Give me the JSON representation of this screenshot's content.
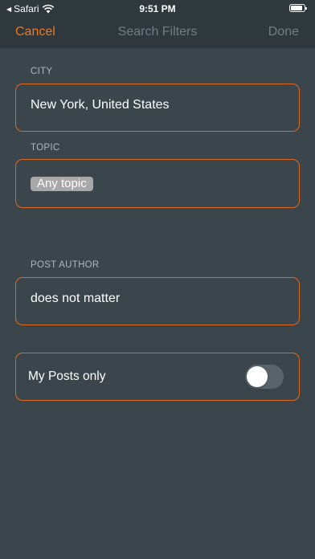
{
  "status_bar": {
    "back_app": "Safari",
    "time": "9:51 PM"
  },
  "nav": {
    "cancel_label": "Cancel",
    "title": "Search Filters",
    "done_label": "Done"
  },
  "city": {
    "label": "CITY",
    "value": "New York, United States"
  },
  "topic": {
    "label": "TOPIC",
    "chip": "Any topic"
  },
  "post_author": {
    "label": "POST AUTHOR",
    "value": "does not matter"
  },
  "my_posts": {
    "label": "My Posts only",
    "enabled": false
  },
  "colors": {
    "accent": "#f0781e",
    "background": "#3b464c",
    "bar": "#2f383d",
    "muted": "#6e7e86"
  },
  "icons": [
    "back-arrow-icon",
    "wifi-icon",
    "battery-icon"
  ]
}
